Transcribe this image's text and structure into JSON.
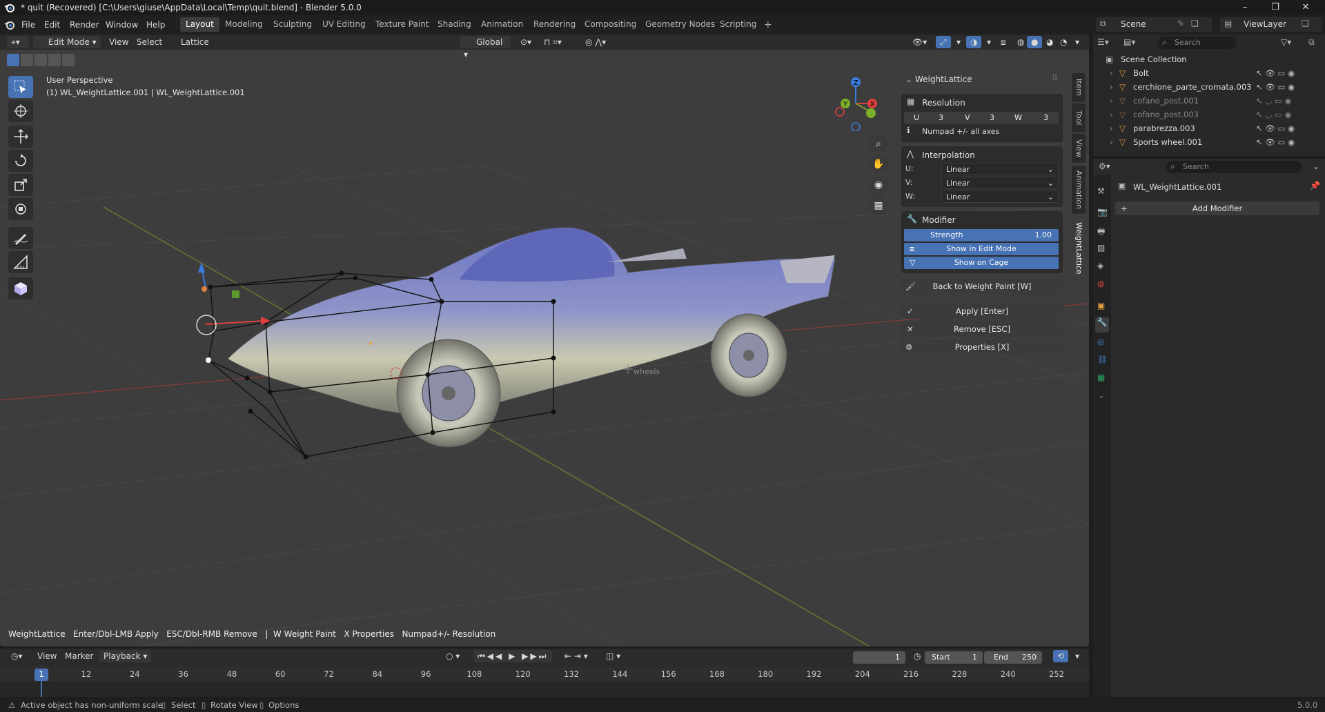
{
  "window": {
    "title": "* quit (Recovered) [C:\\Users\\giuse\\AppData\\Local\\Temp\\quit.blend] - Blender 5.0.0",
    "minimize": "–",
    "maximize": "❐",
    "close": "✕"
  },
  "menu": [
    "File",
    "Edit",
    "Render",
    "Window",
    "Help"
  ],
  "workspaces": [
    "Layout",
    "Modeling",
    "Sculpting",
    "UV Editing",
    "Texture Paint",
    "Shading",
    "Animation",
    "Rendering",
    "Compositing",
    "Geometry Nodes",
    "Scripting"
  ],
  "workspace_active": "Layout",
  "scene": {
    "label": "Scene",
    "view_layer": "ViewLayer"
  },
  "viewport": {
    "mode": "Edit Mode",
    "menus": [
      "View",
      "Select",
      "Lattice"
    ],
    "orientation": "Global",
    "perspective": "User Perspective",
    "object_info": "(1) WL_WeightLattice.001 | WL_WeightLattice.001",
    "empty_label": "wheels",
    "axis": {
      "x": "X",
      "y": "Y",
      "z": "Z"
    },
    "hint": "WeightLattice   Enter/Dbl-LMB Apply   ESC/Dbl-RMB Remove   |  W Weight Paint   X Properties   Numpad+/- Resolution"
  },
  "npanel": {
    "title": "WeightLattice",
    "resolution": {
      "label": "Resolution",
      "u_label": "U",
      "u": "3",
      "v_label": "V",
      "v": "3",
      "w_label": "W",
      "w": "3",
      "note": "Numpad +/- all axes"
    },
    "interpolation": {
      "label": "Interpolation",
      "u_label": "U:",
      "u": "Linear",
      "v_label": "V:",
      "v": "Linear",
      "w_label": "W:",
      "w": "Linear"
    },
    "modifier": {
      "label": "Modifier",
      "strength_label": "Strength",
      "strength": "1.00",
      "show_edit": "Show in Edit Mode",
      "show_cage": "Show on Cage"
    },
    "back_btn": "Back to Weight Paint  [W]",
    "apply_btn": "Apply  [Enter]",
    "remove_btn": "Remove  [ESC]",
    "properties_btn": "Properties  [X]",
    "tabs": [
      "Item",
      "Tool",
      "View",
      "Animation",
      "WeightLattice"
    ]
  },
  "outliner": {
    "search_placeholder": "Search",
    "root": "Scene Collection",
    "items": [
      {
        "name": "Bolt",
        "dim": false
      },
      {
        "name": "cerchione_parte_cromata.003",
        "dim": false
      },
      {
        "name": "cofano_post.001",
        "dim": true
      },
      {
        "name": "cofano_post.003",
        "dim": true
      },
      {
        "name": "parabrezza.003",
        "dim": false
      },
      {
        "name": "Sports wheel.001",
        "dim": false
      }
    ]
  },
  "properties": {
    "search_placeholder": "Search",
    "object_name": "WL_WeightLattice.001",
    "add_modifier": "Add Modifier"
  },
  "timeline": {
    "menus": [
      "View",
      "Marker",
      "Playback"
    ],
    "current_frame": "1",
    "start_label": "Start",
    "start": "1",
    "end_label": "End",
    "end": "250",
    "ticks": [
      "1",
      "12",
      "24",
      "36",
      "48",
      "60",
      "72",
      "84",
      "96",
      "108",
      "120",
      "132",
      "144",
      "156",
      "168",
      "180",
      "192",
      "204",
      "216",
      "228",
      "240",
      "252"
    ]
  },
  "status": {
    "warning": "Active object has non-uniform scale",
    "select": "Select",
    "rotate": "Rotate View",
    "options": "Options",
    "version": "5.0.0"
  },
  "colors": {
    "accent": "#4772b3",
    "viewport_bg": "#3d3d3d",
    "car_body": "#6b74b8"
  }
}
